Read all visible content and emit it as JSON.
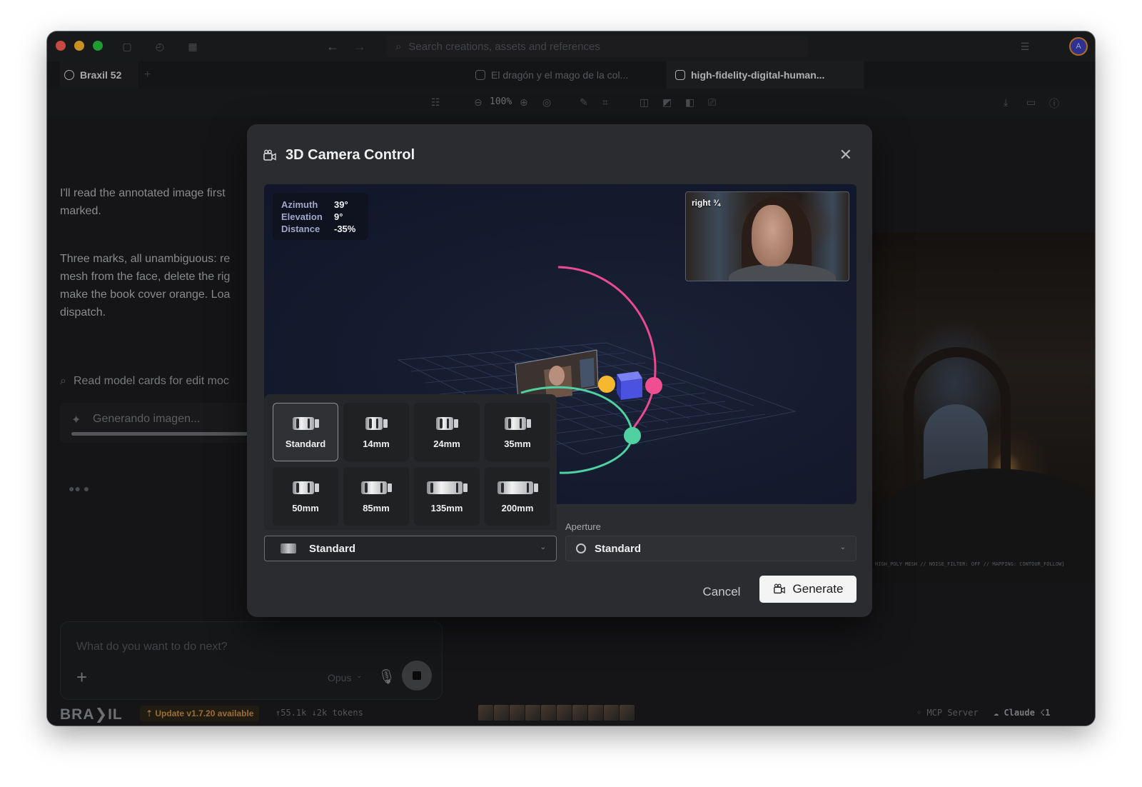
{
  "window": {
    "search_placeholder": "Search creations, assets and references",
    "avatar_initial": "A"
  },
  "tabs": [
    {
      "label": "Braxil 52"
    },
    {
      "label": "El dragón y el mago de la col..."
    },
    {
      "label": "high-fidelity-digital-human..."
    }
  ],
  "toolbar": {
    "zoom": "100%"
  },
  "chat": {
    "message1": "I'll read the annotated image first\nmarked.",
    "message2": "Three marks, all unambiguous: re\nmesh from the face, delete the rig\nmake the book cover orange. Loa\ndispatch.",
    "tool_call": "Read model cards for edit moc",
    "generating": "Generando imagen...",
    "generating_progress": 0.54,
    "input_placeholder": "What do you want to do next?",
    "model": "Opus"
  },
  "background_caption": "HIGH_POLY MESH // NOISE_FILTER: OFF // MAPPING: CONTOUR_FOLLOW]",
  "statusbar": {
    "logo": "BRA❯IL",
    "update": "⇡ Update v1.7.20 available",
    "tokens": "↑55.1k ↓2k tokens",
    "mcp": "◦ MCP Server",
    "claude": "☁ Claude ☇1"
  },
  "dialog": {
    "title": "3D Camera Control",
    "readout": {
      "azimuth_label": "Azimuth",
      "azimuth_value": "39°",
      "elevation_label": "Elevation",
      "elevation_value": "9°",
      "distance_label": "Distance",
      "distance_value": "-35%"
    },
    "preview_label": "right ¾",
    "lenses": [
      {
        "label": "Standard",
        "active": true
      },
      {
        "label": "14mm"
      },
      {
        "label": "24mm"
      },
      {
        "label": "35mm"
      },
      {
        "label": "50mm"
      },
      {
        "label": "85mm"
      },
      {
        "label": "135mm"
      },
      {
        "label": "200mm"
      }
    ],
    "lens_select_value": "Standard",
    "aperture_label": "Aperture",
    "aperture_select_value": "Standard",
    "cancel_label": "Cancel",
    "generate_label": "Generate"
  },
  "colors": {
    "azimuth_arc": "#4fd1a1",
    "elevation_arc": "#e84a8f",
    "handle_yellow": "#f5b82e",
    "cube": "#4b52e0"
  }
}
